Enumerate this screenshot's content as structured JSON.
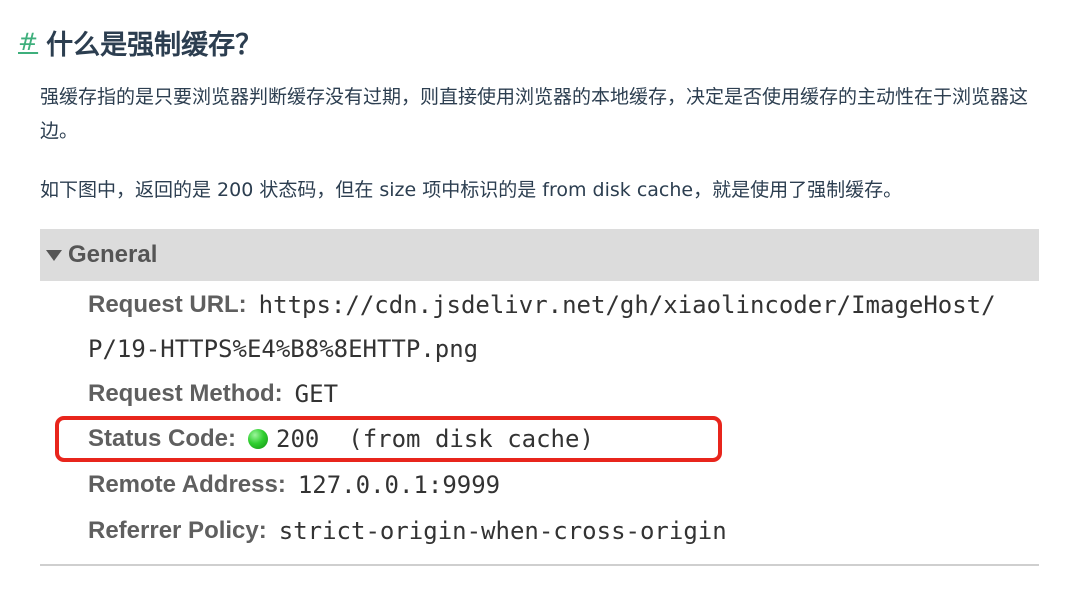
{
  "heading": {
    "anchor": "#",
    "title": "什么是强制缓存？"
  },
  "paragraphs": [
    "强缓存指的是只要浏览器判断缓存没有过期，则直接使用浏览器的本地缓存，决定是否使用缓存的主动性在于浏览器这边。",
    "如下图中，返回的是 200 状态码，但在 size 项中标识的是 from disk cache，就是使用了强制缓存。"
  ],
  "screenshot": {
    "section_title": "General",
    "request_url_label": "Request URL:",
    "request_url_line1": "https://cdn.jsdelivr.net/gh/xiaolincoder/ImageHost/",
    "request_url_line2": "P/19-HTTPS%E4%B8%8EHTTP.png",
    "request_method_label": "Request Method:",
    "request_method_value": "GET",
    "status_code_label": "Status Code:",
    "status_code_value": "200  (from disk cache)",
    "remote_address_label": "Remote Address:",
    "remote_address_value": "127.0.0.1:9999",
    "referrer_policy_label": "Referrer Policy:",
    "referrer_policy_value": "strict-origin-when-cross-origin"
  },
  "colors": {
    "anchor": "#3eaf7c",
    "text": "#2c3e50",
    "highlight_border": "#e8251c",
    "status_dot": "#2fcf2f",
    "header_bg": "#dcdcdc"
  }
}
